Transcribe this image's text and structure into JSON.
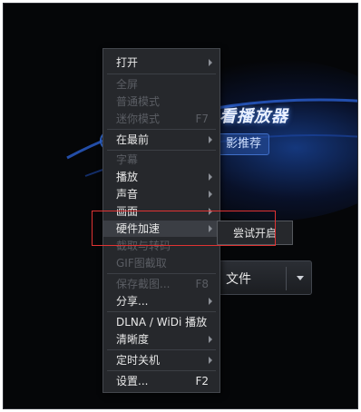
{
  "player": {
    "brand_partial": "看播放器",
    "recommend_partial": "影推荐",
    "open_file_partial": "文件"
  },
  "menu": {
    "items": [
      {
        "label": "打开",
        "enabled": true,
        "has_submenu": true,
        "shortcut": ""
      },
      {
        "label": "全屏",
        "enabled": false,
        "has_submenu": false,
        "shortcut": ""
      },
      {
        "label": "普通模式",
        "enabled": false,
        "has_submenu": false,
        "shortcut": ""
      },
      {
        "label": "迷你模式",
        "enabled": false,
        "has_submenu": false,
        "shortcut": "F7"
      },
      {
        "label": "在最前",
        "enabled": true,
        "has_submenu": true,
        "shortcut": ""
      },
      {
        "label": "字幕",
        "enabled": false,
        "has_submenu": false,
        "shortcut": ""
      },
      {
        "label": "播放",
        "enabled": true,
        "has_submenu": true,
        "shortcut": ""
      },
      {
        "label": "声音",
        "enabled": true,
        "has_submenu": true,
        "shortcut": ""
      },
      {
        "label": "画面",
        "enabled": true,
        "has_submenu": true,
        "shortcut": ""
      },
      {
        "label": "硬件加速",
        "enabled": true,
        "has_submenu": true,
        "shortcut": "",
        "highlighted": true
      },
      {
        "label": "截取与转码",
        "enabled": false,
        "has_submenu": false,
        "shortcut": ""
      },
      {
        "label": "GIF图截取",
        "enabled": false,
        "has_submenu": false,
        "shortcut": ""
      },
      {
        "label": "保存截图...",
        "enabled": false,
        "has_submenu": false,
        "shortcut": "F8"
      },
      {
        "label": "分享...",
        "enabled": true,
        "has_submenu": true,
        "shortcut": ""
      },
      {
        "label": "DLNA / WiDi 播放",
        "enabled": true,
        "has_submenu": false,
        "shortcut": ""
      },
      {
        "label": "清晰度",
        "enabled": true,
        "has_submenu": true,
        "shortcut": ""
      },
      {
        "label": "定时关机",
        "enabled": true,
        "has_submenu": true,
        "shortcut": ""
      },
      {
        "label": "设置...",
        "enabled": true,
        "has_submenu": false,
        "shortcut": "F2"
      }
    ]
  },
  "submenu": {
    "items": [
      {
        "label": "尝试开启"
      }
    ]
  },
  "colors": {
    "highlight_box": "#e03333",
    "menu_bg": "#26282c",
    "accent_blue": "#2f63c6"
  }
}
